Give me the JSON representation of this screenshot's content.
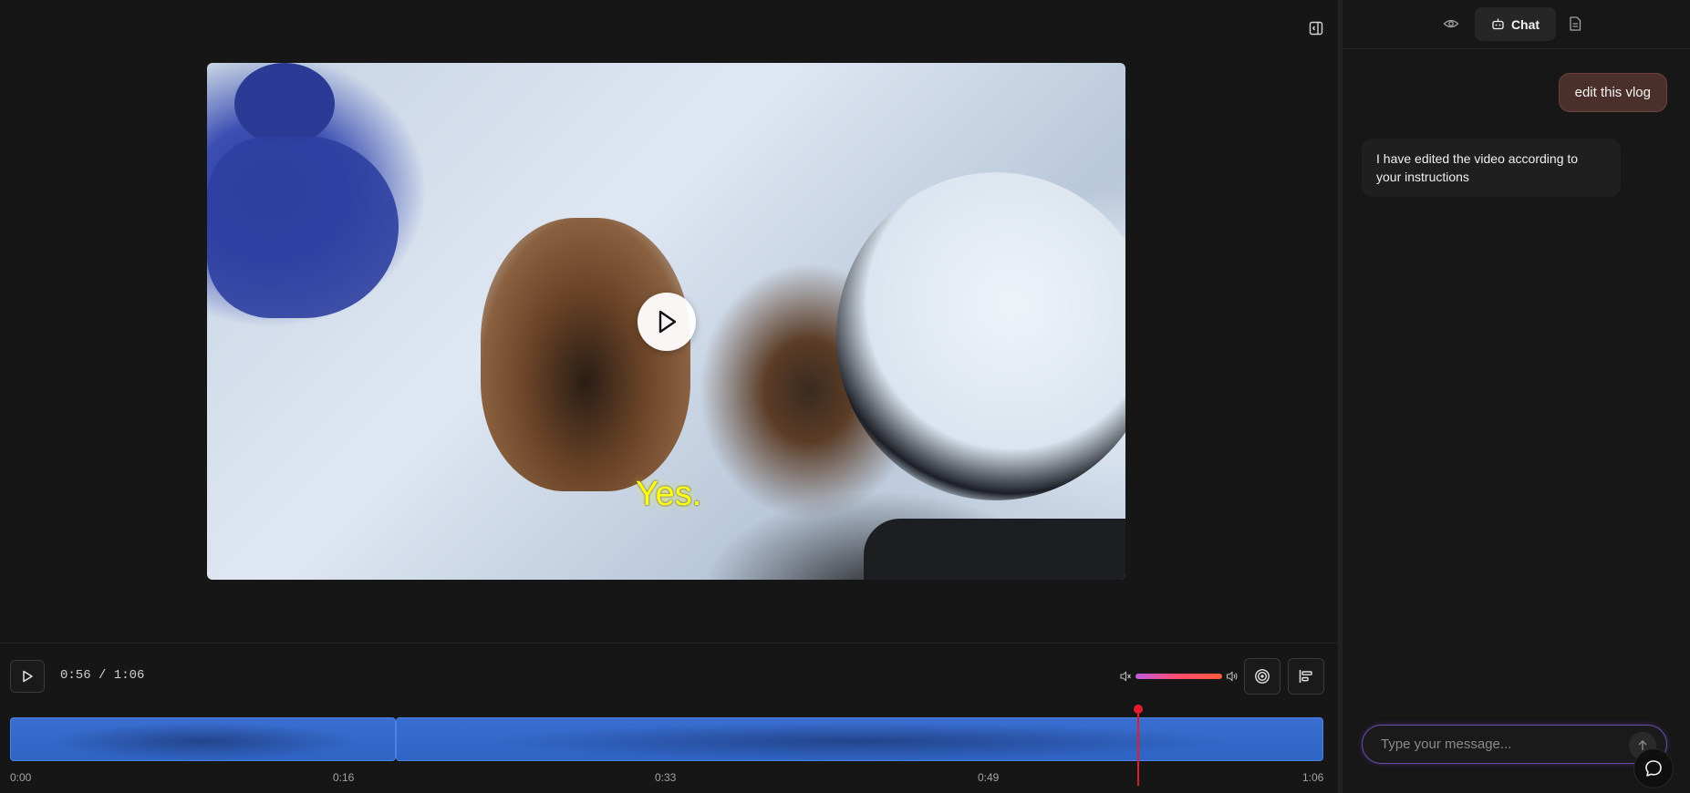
{
  "video": {
    "caption": "Yes.",
    "timecode": "0:56 / 1:06",
    "progress_fraction": 0.85,
    "volume_fraction": 1.0
  },
  "timeline": {
    "ticks": [
      "0:00",
      "0:16",
      "0:33",
      "0:49",
      "1:06"
    ],
    "clips": 2
  },
  "chat": {
    "tab_label": "Chat",
    "messages": [
      {
        "role": "user",
        "text": "edit this vlog"
      },
      {
        "role": "assistant",
        "text": "I have edited the video according to your instructions"
      }
    ],
    "input_placeholder": "Type your message..."
  },
  "icons": {
    "preview": "eye-icon",
    "chat": "robot-icon",
    "document": "document-icon",
    "collapse": "panel-collapse-icon",
    "play": "play-icon",
    "volume_mute": "volume-mute-icon",
    "volume_loud": "volume-loud-icon",
    "target": "target-icon",
    "align": "align-left-icon",
    "send": "arrow-up-icon",
    "fab": "chat-bubble-icon"
  },
  "colors": {
    "background": "#171717",
    "clip": "#3a6fd1",
    "playhead": "#e21d2a",
    "caption": "#ffff1a",
    "user_bubble": "#4a2f2b"
  }
}
